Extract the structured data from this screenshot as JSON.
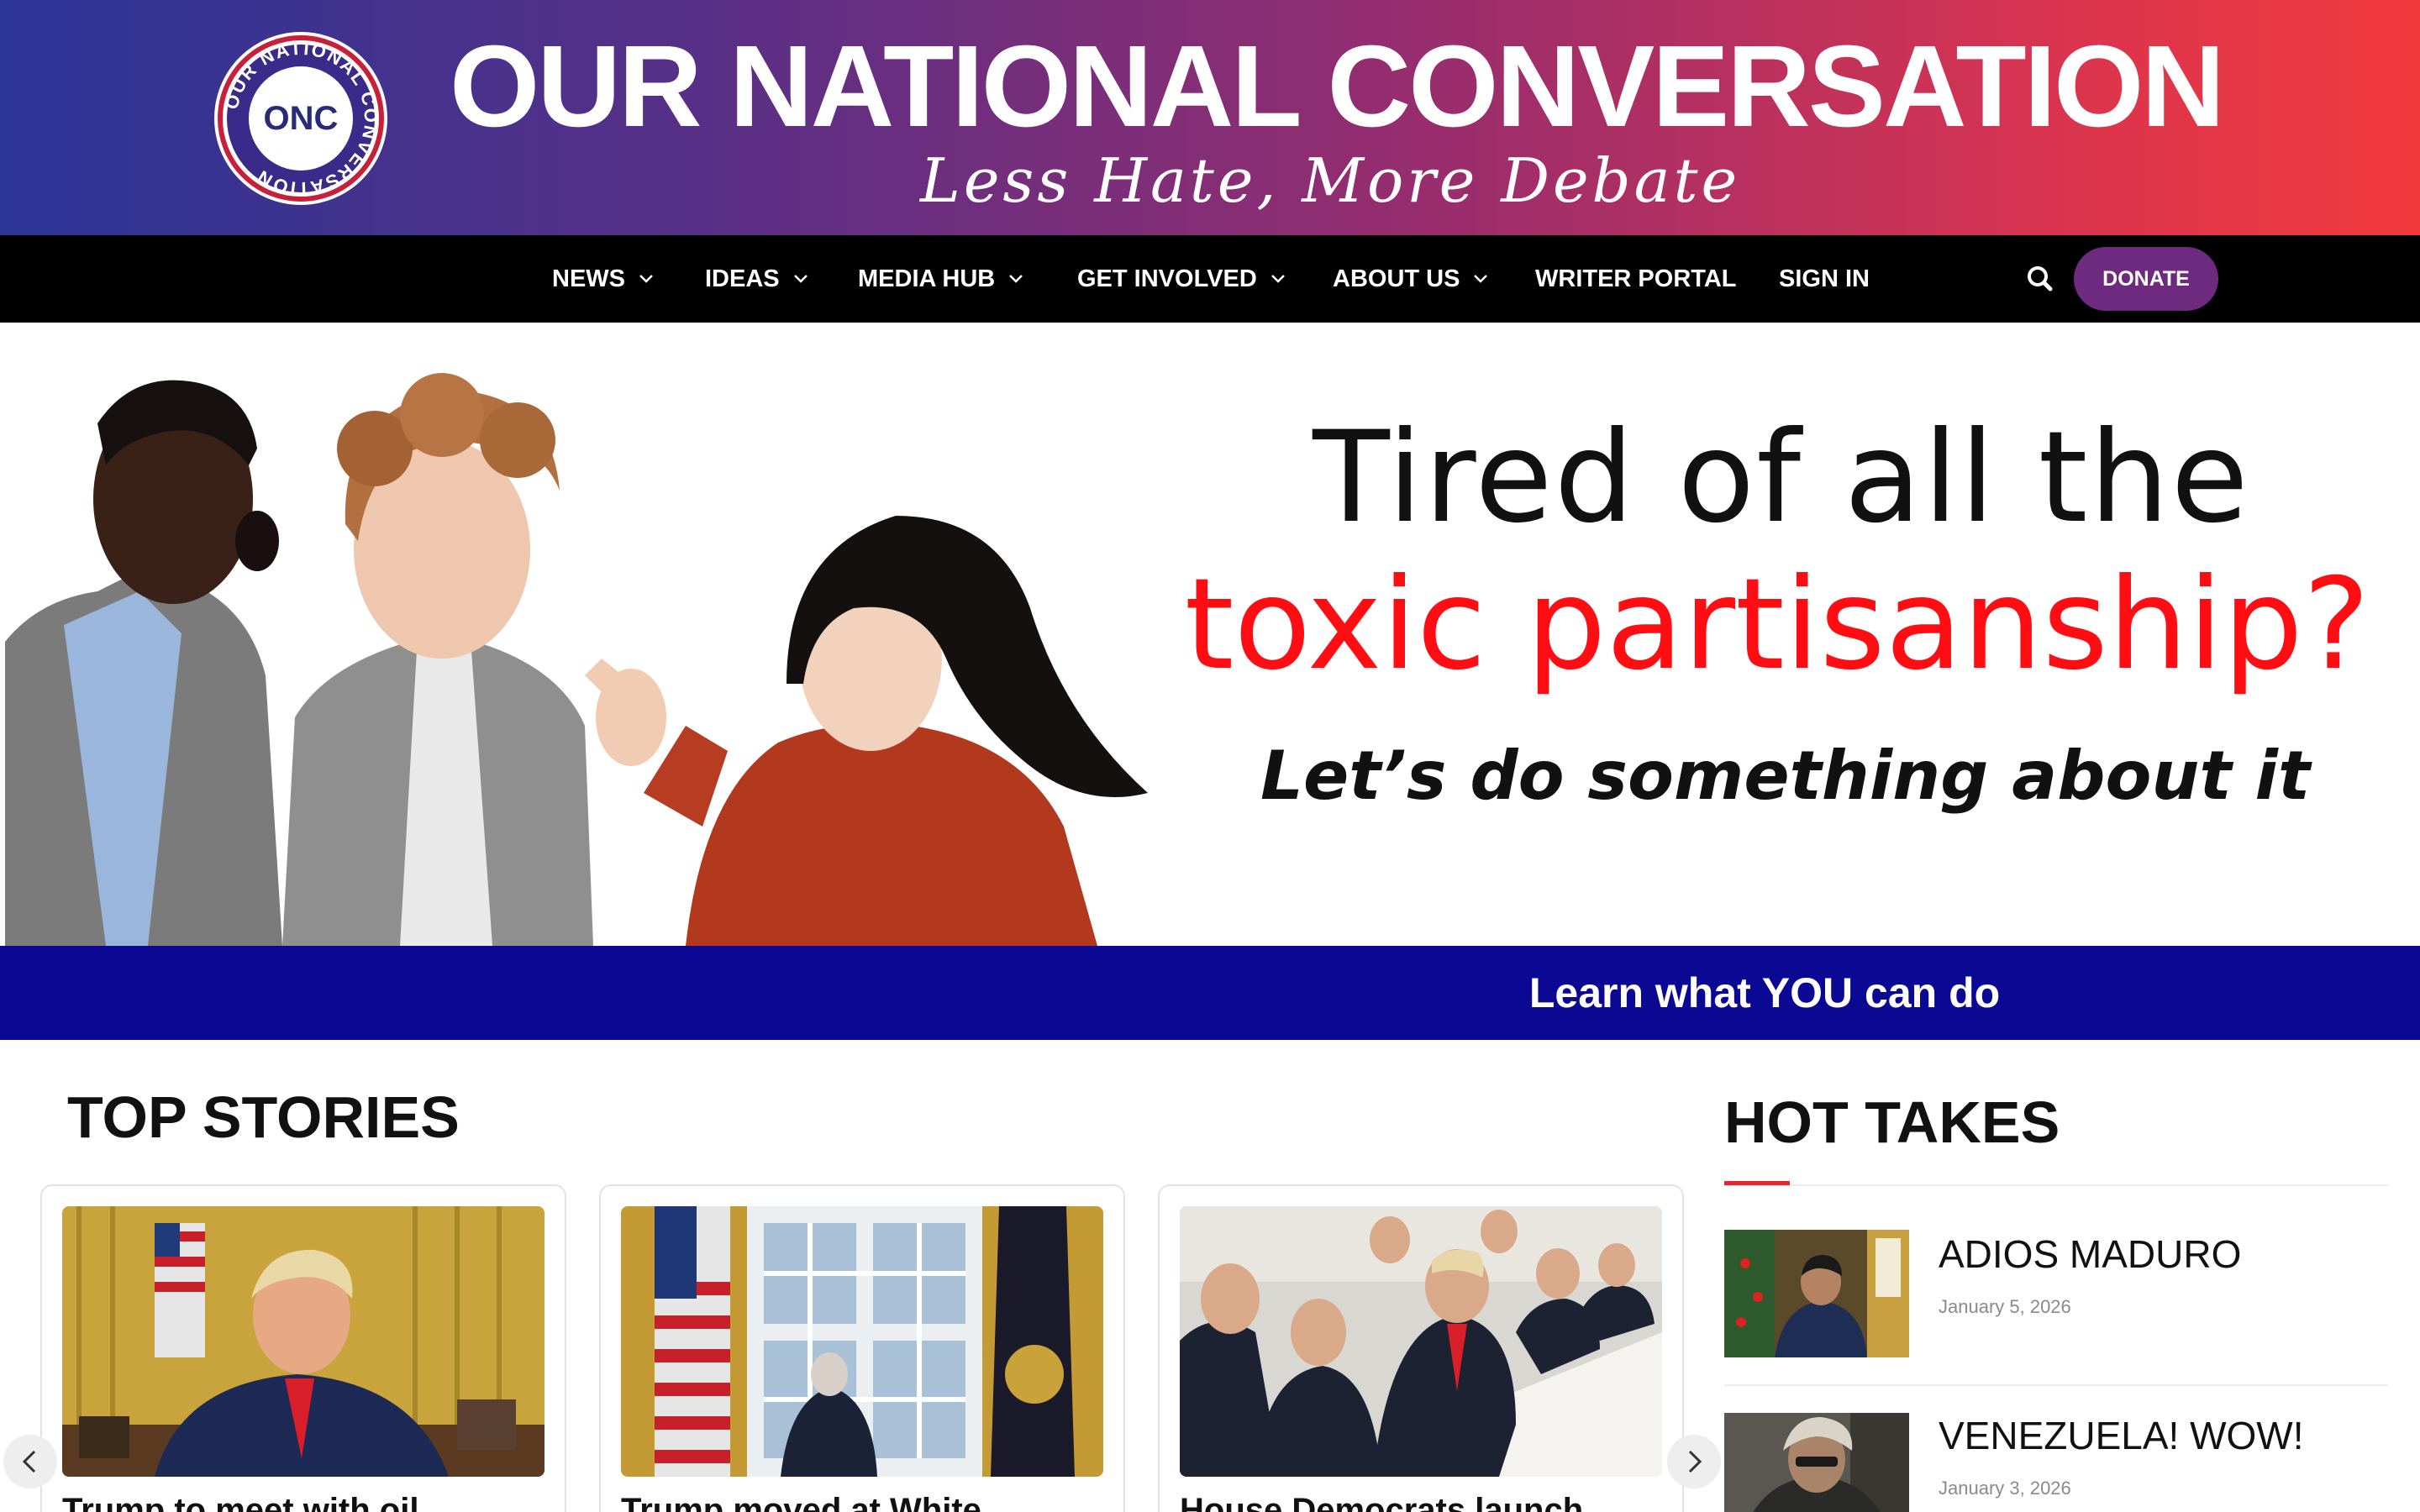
{
  "header": {
    "logo": {
      "text": "ONC",
      "ring_text": "OUR NATIONAL CONVERSATION"
    },
    "title": "OUR NATIONAL CONVERSATION",
    "tagline": "Less Hate, More Debate",
    "gradient_colors": [
      "#2a3596",
      "#5a2f86",
      "#9a2d6d",
      "#f23a3c"
    ]
  },
  "nav": {
    "items": [
      {
        "label": "NEWS",
        "dropdown": true
      },
      {
        "label": "IDEAS",
        "dropdown": true
      },
      {
        "label": "MEDIA HUB",
        "dropdown": true
      },
      {
        "label": "GET INVOLVED",
        "dropdown": true
      },
      {
        "label": "ABOUT US",
        "dropdown": true
      },
      {
        "label": "WRITER PORTAL",
        "dropdown": false
      },
      {
        "label": "SIGN IN",
        "dropdown": false
      }
    ],
    "search_icon": "search-icon",
    "donate_label": "DONATE",
    "donate_color": "#6d2a7f"
  },
  "hero": {
    "line1": "Tired of all the",
    "line2": "toxic partisanship?",
    "line3": "Let’s do something about it",
    "accent_color": "#ff0d12"
  },
  "cta": {
    "label": "Learn what YOU can do",
    "background": "#0b0894"
  },
  "top_stories": {
    "heading": "TOP STORIES",
    "cards": [
      {
        "title": "Trump to meet with oil"
      },
      {
        "title": "Trump moved at White"
      },
      {
        "title": "House Democrats launch"
      }
    ]
  },
  "hot_takes": {
    "heading": "HOT TAKES",
    "accent_color": "#e6262e",
    "items": [
      {
        "title": "ADIOS MADURO",
        "date": "January 5, 2026"
      },
      {
        "title": "VENEZUELA! WOW!",
        "date": "January 3, 2026"
      }
    ]
  }
}
